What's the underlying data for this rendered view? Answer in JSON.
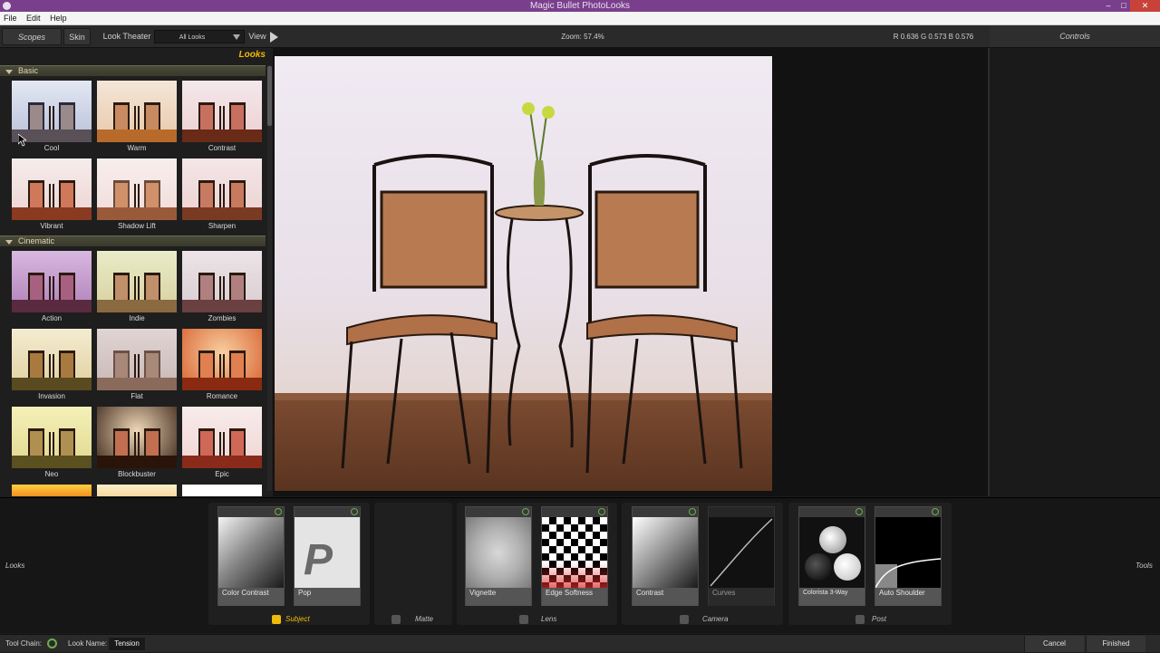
{
  "window": {
    "title": "Magic Bullet PhotoLooks"
  },
  "menu": [
    "File",
    "Edit",
    "Help"
  ],
  "toolbar": {
    "scopes": "Scopes",
    "skin": "Skin",
    "look_theater": "Look Theater",
    "dropdown_value": "All Looks",
    "view": "View",
    "zoom": "Zoom:  57.4%",
    "rgb": "R 0.636   G 0.573   B 0.576",
    "controls": "Controls"
  },
  "looks_panel": {
    "header": "Looks",
    "categories": [
      {
        "name": "Basic",
        "items": [
          "Cool",
          "Warm",
          "Contrast",
          "Vibrant",
          "Shadow Lift",
          "Sharpen"
        ]
      },
      {
        "name": "Cinematic",
        "items": [
          "Action",
          "Indie",
          "Zombies",
          "Invasion",
          "Flat",
          "Romance",
          "Neo",
          "Blockbuster",
          "Epic"
        ]
      }
    ]
  },
  "toolchain": {
    "left_label": "Looks",
    "right_label": "Tools",
    "tiles": [
      {
        "label": "Color Contrast"
      },
      {
        "label": "Pop"
      },
      {
        "label": "Vignette"
      },
      {
        "label": "Edge Softness"
      },
      {
        "label": "Contrast"
      },
      {
        "label": "Curves"
      },
      {
        "label": "Colorista 3-Way"
      },
      {
        "label": "Auto Shoulder"
      }
    ],
    "categories": [
      "Subject",
      "Matte",
      "Lens",
      "Camera",
      "Post"
    ]
  },
  "statusbar": {
    "tool_chain": "Tool Chain:",
    "look_name_label": "Look Name:",
    "look_name_value": "Tension",
    "cancel": "Cancel",
    "finished": "Finished"
  },
  "colors": {
    "accent": "#f0b90a",
    "title_bar": "#7a3f8c",
    "power": "#6ab04c"
  }
}
